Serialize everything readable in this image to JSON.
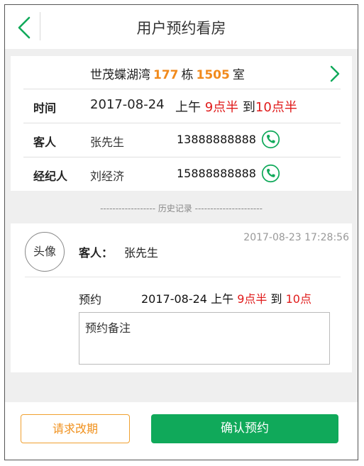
{
  "header": {
    "title": "用户预约看房"
  },
  "address": {
    "name": "世茂蝶湖湾",
    "building": "177",
    "building_unit": "栋",
    "room": "1505",
    "room_unit": "室"
  },
  "time_row": {
    "label": "时间",
    "date": "2017-08-24",
    "period": "上午",
    "start": "9点半",
    "to": "到",
    "end": "10点半"
  },
  "guest_row": {
    "label": "客人",
    "name": "张先生",
    "phone": "13888888888"
  },
  "agent_row": {
    "label": "经纪人",
    "name": "刘经济",
    "phone": "15888888888"
  },
  "history": {
    "label": "------------------  历史记录  ----------------------"
  },
  "record": {
    "avatar": "头像",
    "guest_label": "客人：",
    "guest_name": "张先生",
    "timestamp": "2017-08-23 17:28:56",
    "appt_label": "预约",
    "appt_date": "2017-08-24",
    "appt_period": "上午",
    "appt_start": "9点半",
    "appt_to": "到",
    "appt_end": "10点",
    "note": "预约备注"
  },
  "footer": {
    "reschedule_label": "请求改期",
    "confirm_label": "确认预约"
  },
  "colors": {
    "accent": "#10a95a",
    "orange": "#f18a1c",
    "red": "#e01b1b"
  },
  "icons": {
    "back": "chevron-left-icon",
    "address_arrow": "chevron-right-icon",
    "phone": "phone-icon"
  }
}
